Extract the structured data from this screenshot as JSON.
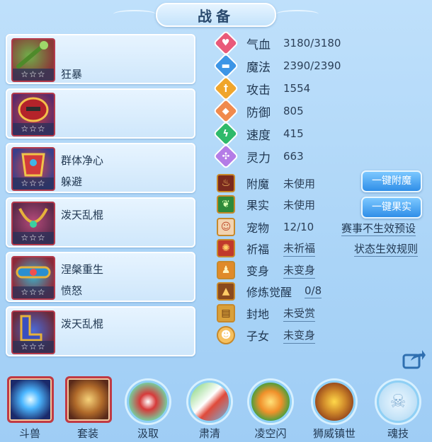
{
  "title": "战备",
  "equipment": [
    {
      "stars": "☆☆☆",
      "line1": "",
      "line2": "狂暴"
    },
    {
      "stars": "☆☆☆",
      "line1": "",
      "line2": ""
    },
    {
      "stars": "☆☆☆",
      "line1": "群体净心",
      "line2": "躲避"
    },
    {
      "stars": "☆☆☆",
      "line1": "泼天乱棍",
      "line2": ""
    },
    {
      "stars": "☆☆☆",
      "line1": "涅槃重生",
      "line2": "愤怒"
    },
    {
      "stars": "☆☆☆",
      "line1": "泼天乱棍",
      "line2": ""
    }
  ],
  "stats": [
    {
      "label": "气血",
      "value": "3180/3180",
      "icon": "heart-icon",
      "color": "#e95a7a"
    },
    {
      "label": "魔法",
      "value": "2390/2390",
      "icon": "mana-icon",
      "color": "#3d95e6"
    },
    {
      "label": "攻击",
      "value": "1554",
      "icon": "sword-icon",
      "color": "#f0a52b"
    },
    {
      "label": "防御",
      "value": "805",
      "icon": "shield-icon",
      "color": "#f08a4d"
    },
    {
      "label": "速度",
      "value": "415",
      "icon": "speed-icon",
      "color": "#2fba6b"
    },
    {
      "label": "灵力",
      "value": "663",
      "icon": "spirit-icon",
      "color": "#b47ce6"
    }
  ],
  "status": [
    {
      "label": "附魔",
      "value": "未使用",
      "icon": "enchant-icon",
      "underlined": false
    },
    {
      "label": "果实",
      "value": "未使用",
      "icon": "fruit-icon",
      "underlined": false
    },
    {
      "label": "宠物",
      "value": "12/10",
      "icon": "pet-icon",
      "underlined": false
    },
    {
      "label": "祈福",
      "value": "未祈福",
      "icon": "bless-icon",
      "underlined": true
    },
    {
      "label": "变身",
      "value": "未变身",
      "icon": "transform-icon",
      "underlined": true
    },
    {
      "label": "修炼觉醒",
      "value": "0/8",
      "icon": "cultivation-icon",
      "underlined": true
    },
    {
      "label": "封地",
      "value": "未受赏",
      "icon": "fief-icon",
      "underlined": true
    },
    {
      "label": "子女",
      "value": "未变身",
      "icon": "child-icon",
      "underlined": true
    }
  ],
  "buttons": {
    "enchant": "一键附魔",
    "fruit": "一键果实"
  },
  "links": {
    "preset": "赛事不生效预设",
    "rules": "状态生效规则"
  },
  "bottom": [
    {
      "label": "斗兽",
      "icon": "beast-orb-icon"
    },
    {
      "label": "套装",
      "icon": "suit-icon"
    },
    {
      "label": "汲取",
      "icon": "absorb-icon"
    },
    {
      "label": "肃清",
      "icon": "purge-icon"
    },
    {
      "label": "凌空闪",
      "icon": "flash-icon"
    },
    {
      "label": "狮威镇世",
      "icon": "lion-icon"
    },
    {
      "label": "魂技",
      "icon": "soul-skill-icon"
    }
  ]
}
